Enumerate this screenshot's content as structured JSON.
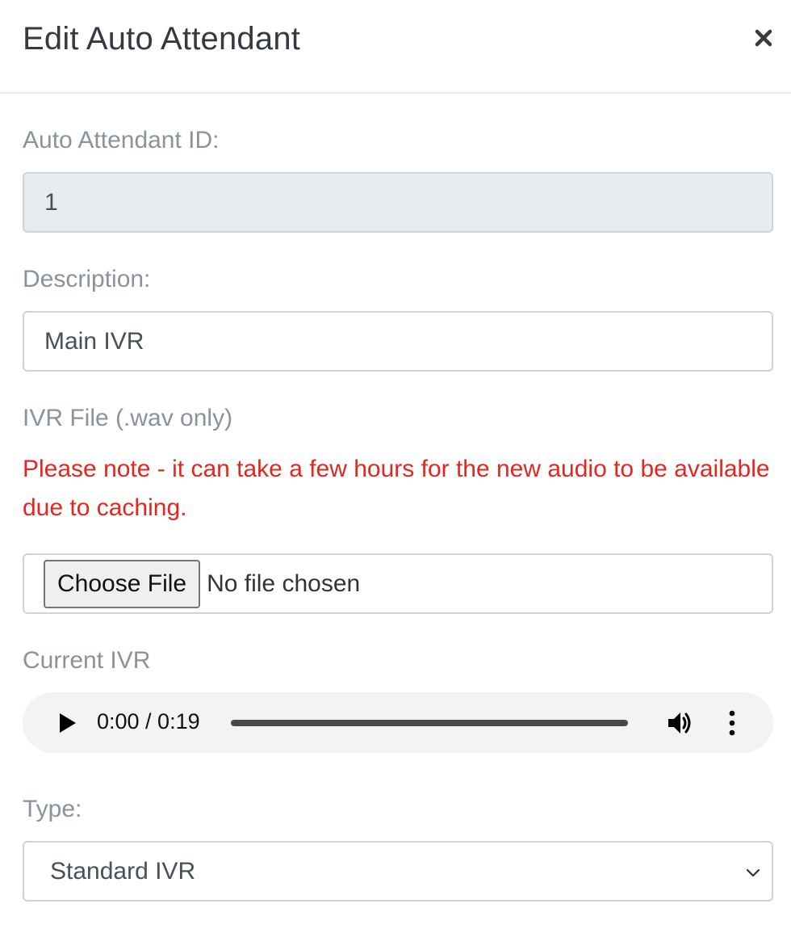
{
  "modal": {
    "title": "Edit Auto Attendant",
    "close_icon": "close-icon"
  },
  "form": {
    "id_label": "Auto Attendant ID:",
    "id_value": "1",
    "description_label": "Description:",
    "description_value": "Main IVR",
    "ivr_file_label": "IVR File (.wav only)",
    "ivr_note": "Please note - it can take a few hours for the new audio to be available due to caching.",
    "file_button_label": "Choose File",
    "file_status": "No file chosen",
    "current_ivr_label": "Current IVR",
    "type_label": "Type:",
    "type_selected": "Standard IVR"
  },
  "audio": {
    "time_display": "0:00 / 0:19",
    "progress": 0,
    "icons": [
      "play-icon",
      "volume-icon",
      "more-vertical-icon"
    ]
  },
  "colors": {
    "note_red": "#e3271f",
    "label_gray": "#8a939d",
    "title_dark": "#343a40",
    "readonly_bg": "#e9ecef"
  }
}
